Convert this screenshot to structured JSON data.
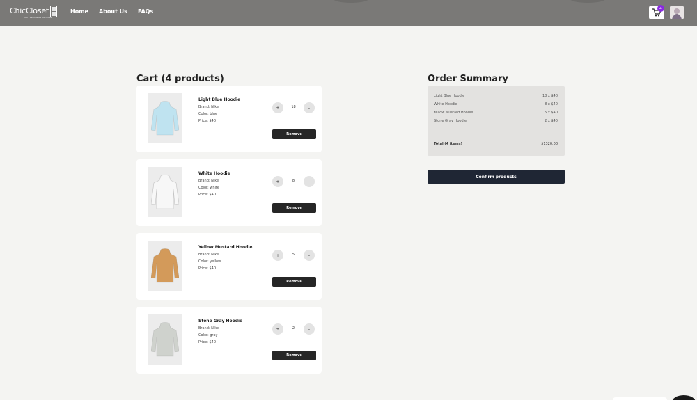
{
  "brand": {
    "name": "ChicCloset",
    "tagline": "Your Fashionable Wardrobe"
  },
  "nav": [
    "Home",
    "About Us",
    "FAQs"
  ],
  "header": {
    "cart_count": "4"
  },
  "cart": {
    "title": "Cart (4 products)",
    "remove_label": "Remove",
    "items": [
      {
        "name": "Light Blue Hoodie",
        "brand": "Brand: Nike",
        "color": "Color: blue",
        "price": "Price: $40",
        "qty": "18",
        "swatch": "#bfe3f0"
      },
      {
        "name": "White Hoodie",
        "brand": "Brand: Nike",
        "color": "Color: white",
        "price": "Price: $40",
        "qty": "8",
        "swatch": "#f7f7f7"
      },
      {
        "name": "Yellow Mustard Hoodie",
        "brand": "Brand: Nike",
        "color": "Color: yellow",
        "price": "Price: $40",
        "qty": "5",
        "swatch": "#d39a5a"
      },
      {
        "name": "Stone Gray Hoodie",
        "brand": "Brand: Nike",
        "color": "Color: gray",
        "price": "Price: $40",
        "qty": "2",
        "swatch": "#cfd2cd"
      }
    ]
  },
  "summary": {
    "title": "Order Summary",
    "rows": [
      {
        "label": "Light Blue Hoodie",
        "value": "18 x $40"
      },
      {
        "label": "White Hoodie",
        "value": "8 x $40"
      },
      {
        "label": "Yellow Mustard Hoodie",
        "value": "5 x $40"
      },
      {
        "label": "Stone Gray Hoodie",
        "value": "2 x $40"
      }
    ],
    "total_label": "Total (4 items)",
    "total_value": "$1320.00",
    "confirm_label": "Confirm products"
  },
  "colors": {
    "topbar": "#7a7977",
    "confirm": "#1f2634",
    "remove": "#262626",
    "badge": "#8a2be2"
  },
  "icons": {
    "cart": "cart-icon",
    "plus": "plus-icon",
    "minus": "minus-icon"
  }
}
